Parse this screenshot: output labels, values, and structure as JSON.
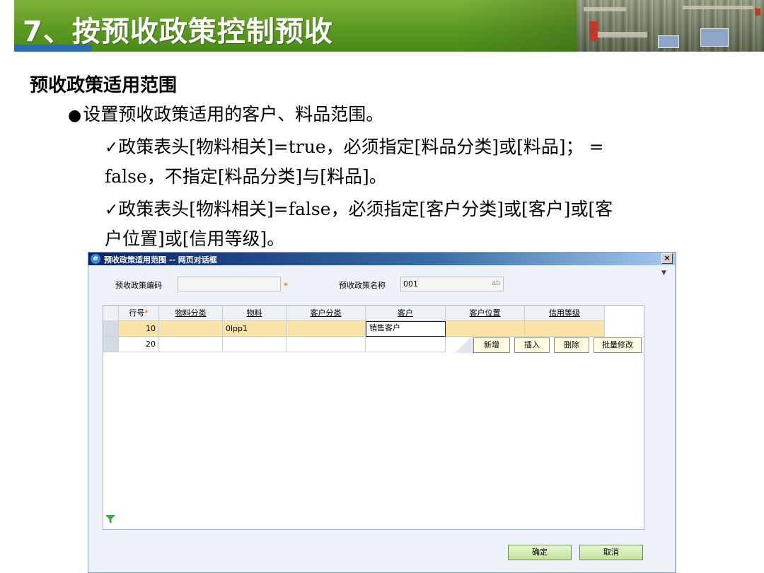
{
  "slide": {
    "title": "7、按预收政策控制预收",
    "heading": "预收政策适用范围",
    "bullet": "设置预收政策适用的客户、料品范围。",
    "rule1_line1": "政策表头[物料相关]=true，必须指定[料品分类]或[料品]； =",
    "rule1_line2": "false，不指定[料品分类]与[料品]。",
    "rule2_line1": "政策表头[物料相关]=false，必须指定[客户分类]或[客户]或[客",
    "rule2_line2": "户位置]或[信用等级]。"
  },
  "dialog": {
    "title": "预收政策适用范围 -- 网页对话框",
    "close_glyph": "×",
    "code_label": "预收政策编码",
    "code_value": "",
    "required_mark": "*",
    "name_label": "预收政策名称",
    "name_value": "001",
    "name_type_tag": "ab",
    "grid": {
      "columns": [
        "行号",
        "物料分类",
        "物料",
        "客户分类",
        "客户",
        "客户位置",
        "信用等级"
      ],
      "rows": [
        {
          "line": "10",
          "material_category": "",
          "material": "0lpp1",
          "customer_category": "",
          "customer": "销售客户",
          "customer_location": "",
          "credit_level": ""
        },
        {
          "line": "20",
          "material_category": "",
          "material": "",
          "customer_category": "",
          "customer": "",
          "customer_location": "",
          "credit_level": ""
        }
      ],
      "row_buttons": [
        "新增",
        "插入",
        "删除",
        "批量修改"
      ]
    },
    "ok_label": "确定",
    "cancel_label": "取消"
  }
}
